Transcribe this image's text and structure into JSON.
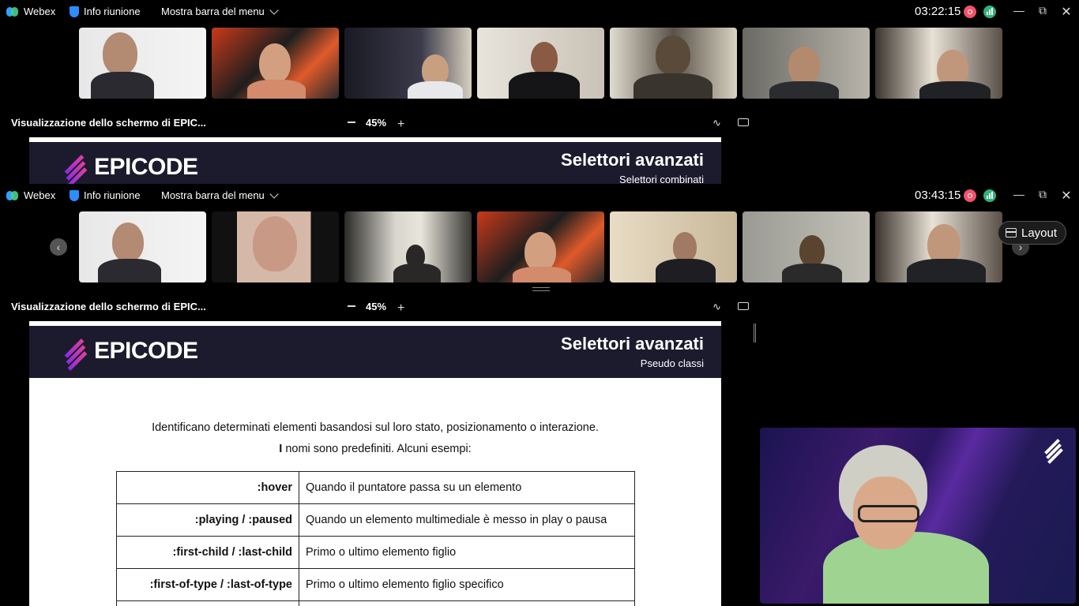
{
  "app": {
    "name": "Webex"
  },
  "windows": [
    {
      "titlebar": {
        "meeting_info": "Info riunione",
        "menu_toggle": "Mostra barra del menu",
        "clock": "03:22:15"
      },
      "sharebar": {
        "label": "Visualizzazione dello schermo di EPIC...",
        "zoom": "45%"
      },
      "slide": {
        "brand": "EPICODE",
        "title": "Selettori avanzati",
        "subtitle": "Selettori combinati"
      }
    },
    {
      "titlebar": {
        "meeting_info": "Info riunione",
        "menu_toggle": "Mostra barra del menu",
        "clock": "03:43:15"
      },
      "layout_button": "Layout",
      "sharebar": {
        "label": "Visualizzazione dello schermo di EPIC...",
        "zoom": "45%"
      },
      "slide": {
        "brand": "EPICODE",
        "title": "Selettori avanzati",
        "subtitle": "Pseudo classi",
        "intro_line1": "Identificano determinati elementi basandosi sul loro stato, posizionamento o interazione.",
        "intro_line2_bold": "I",
        "intro_line2": " nomi sono predefiniti. Alcuni esempi:",
        "table": [
          {
            "selector": ":hover",
            "description": "Quando il puntatore passa su un elemento"
          },
          {
            "selector": ":playing / :paused",
            "description": "Quando un elemento multimediale è messo in play o pausa"
          },
          {
            "selector": ":first-child / :last-child",
            "description": "Primo o ultimo elemento figlio"
          },
          {
            "selector": ":first-of-type / :last-of-type",
            "description": "Primo o ultimo elemento figlio specifico"
          }
        ]
      }
    }
  ],
  "colors": {
    "slide_band": "#1c1b2e",
    "recording": "#f0536a",
    "signal": "#2fb37a",
    "brand_gradient_start": "#8a2be2",
    "brand_gradient_end": "#e0409b"
  },
  "icons": {
    "webex": "webex-logo-icon",
    "info": "shield-icon",
    "menu": "chevron-down-icon",
    "recording": "recording-icon",
    "network": "signal-icon",
    "minimize": "minimize-icon",
    "restore": "restore-icon",
    "close": "close-icon",
    "annotate": "annotate-icon",
    "popout": "popout-icon",
    "layout": "calendar-layout-icon"
  }
}
